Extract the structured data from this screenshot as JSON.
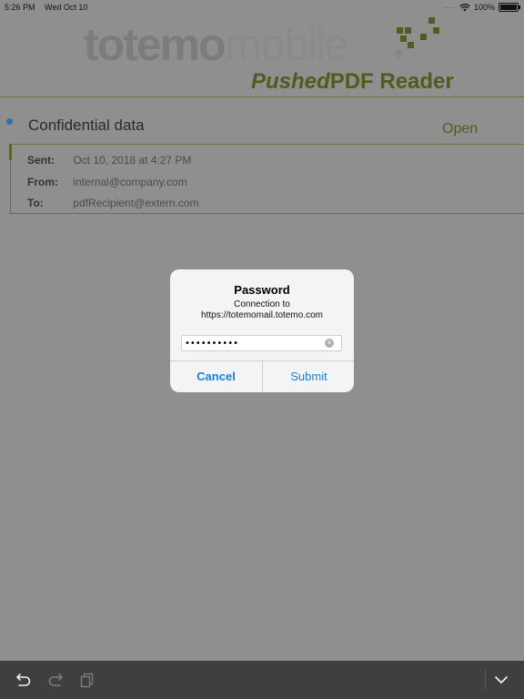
{
  "status_bar": {
    "time": "5:26 PM",
    "date": "Wed Oct 10",
    "battery": "100%"
  },
  "header": {
    "brand_bold": "totemo",
    "brand_light": "mobile",
    "registered": "®",
    "product_italic": "Pushed",
    "product_rest": "PDF Reader"
  },
  "message": {
    "subject": "Confidential data",
    "open_label": "Open",
    "sent_label": "Sent:",
    "sent_value": "Oct 10, 2018 at 4:27 PM",
    "from_label": "From:",
    "from_value": "internal@company.com",
    "to_label": "To:",
    "to_value": "pdfRecipient@extern.com"
  },
  "dialog": {
    "title": "Password",
    "message_line1": "Connection to",
    "message_line2": "https://totemomail.totemo.com",
    "password_value": "••••••••••",
    "cancel_label": "Cancel",
    "submit_label": "Submit"
  },
  "toolbar": {
    "icons": [
      "undo-icon",
      "redo-icon",
      "copy-icon",
      "chevron-down-icon"
    ]
  },
  "colors": {
    "background": "#8f8f8f",
    "accent_green": "#4e5d1e",
    "link_blue": "#1a7ee0",
    "toolbar": "#3f3f3f"
  }
}
